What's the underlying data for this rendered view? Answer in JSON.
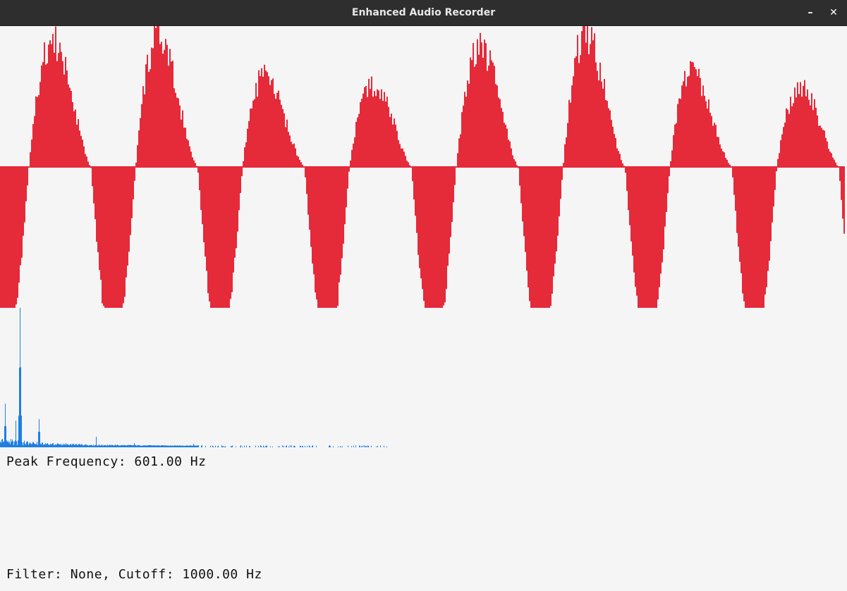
{
  "window": {
    "title": "Enhanced Audio Recorder",
    "minimize_glyph": "–",
    "close_glyph": "✕"
  },
  "info": {
    "peak_frequency": "Peak Frequency: 601.00 Hz",
    "filter_status": "Filter: None, Cutoff: 1000.00 Hz"
  },
  "colors": {
    "waveform": "#e52a3a",
    "spectrum": "#1e7fe0",
    "background": "#f5f5f5",
    "titlebar": "#2e2e2e"
  },
  "icons": {
    "minimize": "minimize-icon",
    "close": "close-icon"
  }
}
